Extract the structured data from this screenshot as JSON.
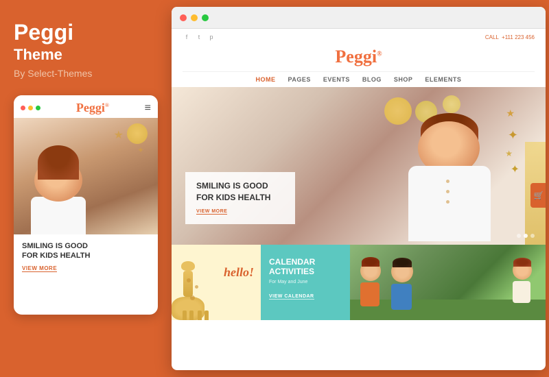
{
  "left": {
    "theme_name": "Peggi",
    "theme_label": "Theme",
    "by_line": "By Select-Themes",
    "mobile": {
      "logo": "Peggi",
      "hero_title": "SMILING IS GOOD\nFOR KIDS HEALTH",
      "view_more": "VIEW MORE"
    }
  },
  "browser": {
    "dots": [
      "red",
      "yellow",
      "green"
    ],
    "site": {
      "social_icons": [
        "f",
        "t",
        "p"
      ],
      "call_label": "CALL",
      "call_number": "+111 223 456",
      "logo": "Peggi",
      "nav_items": [
        {
          "label": "HOME",
          "active": true
        },
        {
          "label": "PAGES",
          "active": false
        },
        {
          "label": "EVENTS",
          "active": false
        },
        {
          "label": "BLOG",
          "active": false
        },
        {
          "label": "SHOP",
          "active": false
        },
        {
          "label": "ELEMENTS",
          "active": false
        }
      ],
      "hero": {
        "title": "SMILING IS GOOD\nFOR KIDS HEALTH",
        "view_more": "VIEW MORE"
      },
      "thumbs": {
        "hello_text": "hello!",
        "calendar_title": "CALENDAR\nACTIVITIES",
        "calendar_sub": "For May and June",
        "calendar_link": "VIEW CALENDAR"
      }
    }
  },
  "colors": {
    "orange": "#d9622e",
    "teal": "#5cc8c0",
    "logo_orange": "#f07040",
    "light_orange": "#f5dcc8"
  }
}
